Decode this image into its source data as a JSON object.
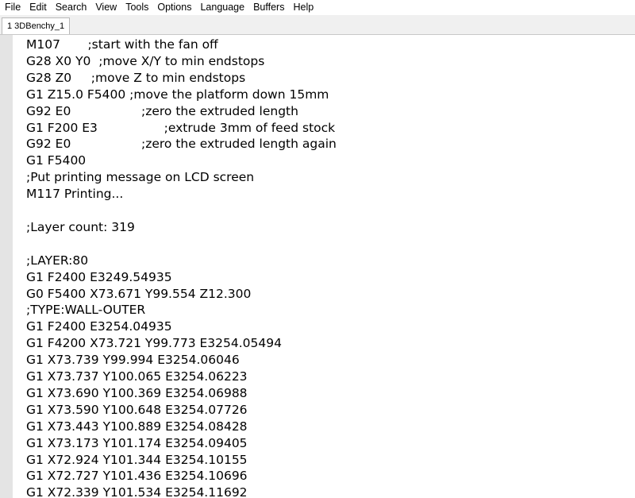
{
  "menu": [
    "File",
    "Edit",
    "Search",
    "View",
    "Tools",
    "Options",
    "Language",
    "Buffers",
    "Help"
  ],
  "tabs": [
    {
      "label": "1 3DBenchy_1"
    }
  ],
  "lines": [
    "M107       ;start with the fan off",
    "G28 X0 Y0  ;move X/Y to min endstops",
    "G28 Z0     ;move Z to min endstops",
    "G1 Z15.0 F5400 ;move the platform down 15mm",
    "G92 E0                  ;zero the extruded length",
    "G1 F200 E3                 ;extrude 3mm of feed stock",
    "G92 E0                  ;zero the extruded length again",
    "G1 F5400",
    ";Put printing message on LCD screen",
    "M117 Printing...",
    "",
    ";Layer count: 319",
    "",
    ";LAYER:80",
    "G1 F2400 E3249.54935",
    "G0 F5400 X73.671 Y99.554 Z12.300",
    ";TYPE:WALL-OUTER",
    "G1 F2400 E3254.04935",
    "G1 F4200 X73.721 Y99.773 E3254.05494",
    "G1 X73.739 Y99.994 E3254.06046",
    "G1 X73.737 Y100.065 E3254.06223",
    "G1 X73.690 Y100.369 E3254.06988",
    "G1 X73.590 Y100.648 E3254.07726",
    "G1 X73.443 Y100.889 E3254.08428",
    "G1 X73.173 Y101.174 E3254.09405",
    "G1 X72.924 Y101.344 E3254.10155",
    "G1 X72.727 Y101.436 E3254.10696",
    "G1 X72.339 Y101.534 E3254.11692"
  ]
}
